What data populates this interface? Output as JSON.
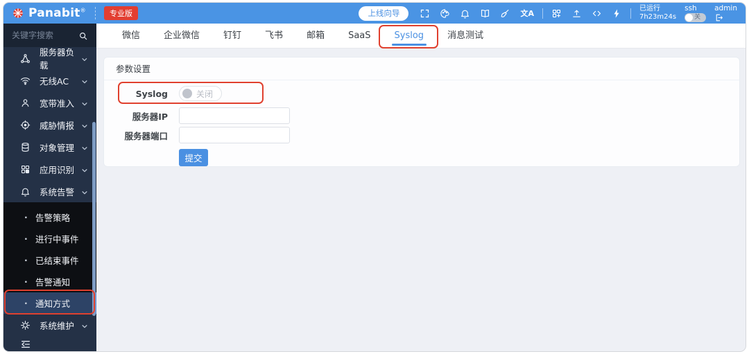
{
  "header": {
    "brand": "Panabit",
    "brand_reg": "®",
    "edition_badge": "专业版",
    "wizard_button": "上线向导",
    "icon_glyphs": {
      "translate": "文A"
    },
    "icons": [
      "fullscreen-icon",
      "palette-icon",
      "bell-icon",
      "book-icon",
      "broom-icon",
      "translate-icon",
      "app-grid-icon",
      "upload-icon",
      "code-icon",
      "bolt-icon"
    ],
    "uptime_label": "已运行",
    "uptime_value": "7h23m24s",
    "ssh_label": "ssh",
    "ssh_toggle_state": "关",
    "username": "admin"
  },
  "sidebar": {
    "search_placeholder": "关键字搜索",
    "menu": [
      {
        "label": "服务器负载",
        "icon": "share-nodes-icon"
      },
      {
        "label": "无线AC",
        "icon": "wifi-icon"
      },
      {
        "label": "宽带准入",
        "icon": "user-icon"
      },
      {
        "label": "威胁情报",
        "icon": "target-icon"
      },
      {
        "label": "对象管理",
        "icon": "database-icon"
      },
      {
        "label": "应用识别",
        "icon": "apps-icon"
      },
      {
        "label": "系统告警",
        "icon": "bell-icon"
      }
    ],
    "submenu": [
      {
        "label": "告警策略"
      },
      {
        "label": "进行中事件"
      },
      {
        "label": "已结束事件"
      },
      {
        "label": "告警通知"
      },
      {
        "label": "通知方式",
        "selected": true
      }
    ],
    "maintenance": {
      "label": "系统维护",
      "icon": "gear-icon"
    }
  },
  "tabs": {
    "active": "Syslog",
    "items": [
      {
        "label": "微信"
      },
      {
        "label": "企业微信"
      },
      {
        "label": "钉钉"
      },
      {
        "label": "飞书"
      },
      {
        "label": "邮箱"
      },
      {
        "label": "SaaS"
      },
      {
        "label": "Syslog"
      },
      {
        "label": "消息测试"
      }
    ]
  },
  "panel": {
    "title": "参数设置",
    "syslog_label": "Syslog",
    "syslog_toggle_text": "关闭",
    "fields": [
      {
        "label": "服务器IP",
        "value": ""
      },
      {
        "label": "服务器端口",
        "value": ""
      }
    ],
    "submit_label": "提交"
  },
  "colors": {
    "header_bg": "#4a94e4",
    "badge_red": "#e23e31",
    "accent_blue": "#4a90e2",
    "annotation_red": "#e0402e",
    "sidebar_bg": "#243146",
    "sidebar_search_bg": "#1a2433",
    "submenu_bg": "#0d0f13",
    "selected_item_bg": "#2d4366",
    "scrollbar": "#7e9cc4",
    "content_bg": "#eef0f5"
  }
}
